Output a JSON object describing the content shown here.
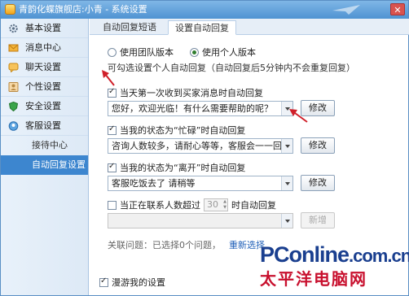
{
  "window": {
    "title": "青韵化蝶旗舰店:小青 - 系统设置"
  },
  "sidebar": {
    "items": [
      {
        "label": "基本设置",
        "icon": "gear-icon"
      },
      {
        "label": "消息中心",
        "icon": "envelope-icon"
      },
      {
        "label": "聊天设置",
        "icon": "chat-icon"
      },
      {
        "label": "个性设置",
        "icon": "person-icon"
      },
      {
        "label": "安全设置",
        "icon": "shield-icon"
      },
      {
        "label": "客服设置",
        "icon": "headset-icon"
      }
    ],
    "sub_items": [
      {
        "label": "接待中心",
        "active": false
      },
      {
        "label": "自动回复设置",
        "active": true
      }
    ]
  },
  "tabs": [
    {
      "label": "自动回复短语",
      "active": false
    },
    {
      "label": "设置自动回复",
      "active": true
    }
  ],
  "version": {
    "team_label": "使用团队版本",
    "personal_label": "使用个人版本",
    "selected": "personal"
  },
  "note": "可勾选设置个人自动回复（自动回复后5分钟内不会重复回复）",
  "rules": [
    {
      "label": "当天第一次收到买家消息时自动回复",
      "checked": true,
      "value": "您好，欢迎光临！有什么需要帮助的呢？",
      "button": "修改"
    },
    {
      "label": "当我的状态为“忙碌”时自动回复",
      "checked": true,
      "value": "咨询人数较多，请耐心等等，客服会一一回",
      "button": "修改"
    },
    {
      "label": "当我的状态为“离开”时自动回复",
      "checked": true,
      "value": "客服吃饭去了 请稍等",
      "button": "修改"
    }
  ],
  "contact_rule": {
    "label_before": "当正在联系人数超过",
    "count": "30",
    "label_after": "时自动回复",
    "checked": false,
    "value": "",
    "button": "新增"
  },
  "linked": {
    "text": "关联问题：已选择0个问题，",
    "link": "重新选择"
  },
  "footer": {
    "roam_label": "漫游我的设置",
    "roam_checked": true
  },
  "watermark": {
    "brand": "PConline",
    "domain": ".com.cn",
    "chinese": "太平洋电脑网"
  },
  "colors": {
    "accent": "#3d86cf",
    "titlebar": "#4f93d2",
    "annotation_arrow": "#d0202a"
  }
}
